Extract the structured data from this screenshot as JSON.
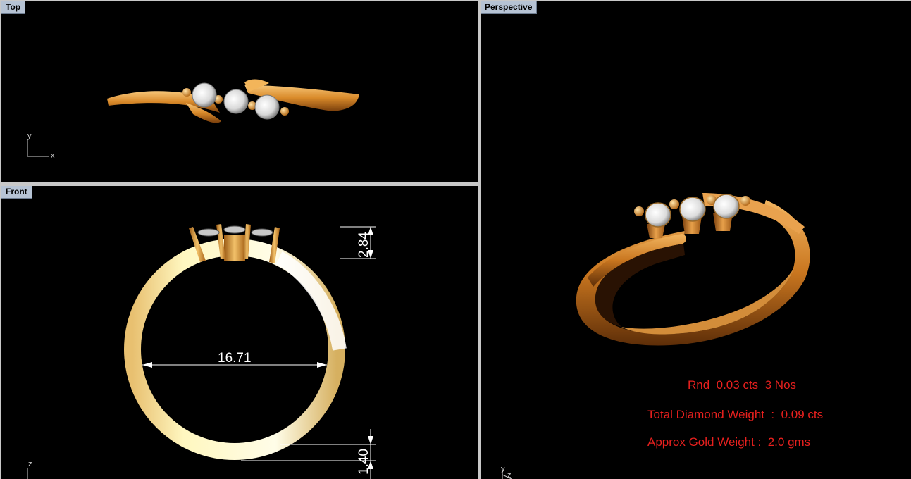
{
  "viewports": {
    "top": {
      "title": "Top",
      "axes": {
        "y": "y",
        "x": "x"
      }
    },
    "front": {
      "title": "Front",
      "axes": {
        "z": "z"
      }
    },
    "perspective": {
      "title": "Perspective",
      "axes": {
        "y": "y",
        "z": "z"
      }
    }
  },
  "dimensions": {
    "inner_diameter": "16.71",
    "top_height": "2.84",
    "band_thickness": "1.40"
  },
  "specs": {
    "line1": "Rnd  0.03 cts  3 Nos",
    "line2": "Total Diamond Weight  :  0.09 cts",
    "line3": "Approx Gold Weight :  2.0 gms"
  },
  "colors": {
    "viewport_bg": "#000000",
    "title_tab": "#b6c3d4",
    "gold": "#d98a2a",
    "spec_text": "#e8201e"
  }
}
